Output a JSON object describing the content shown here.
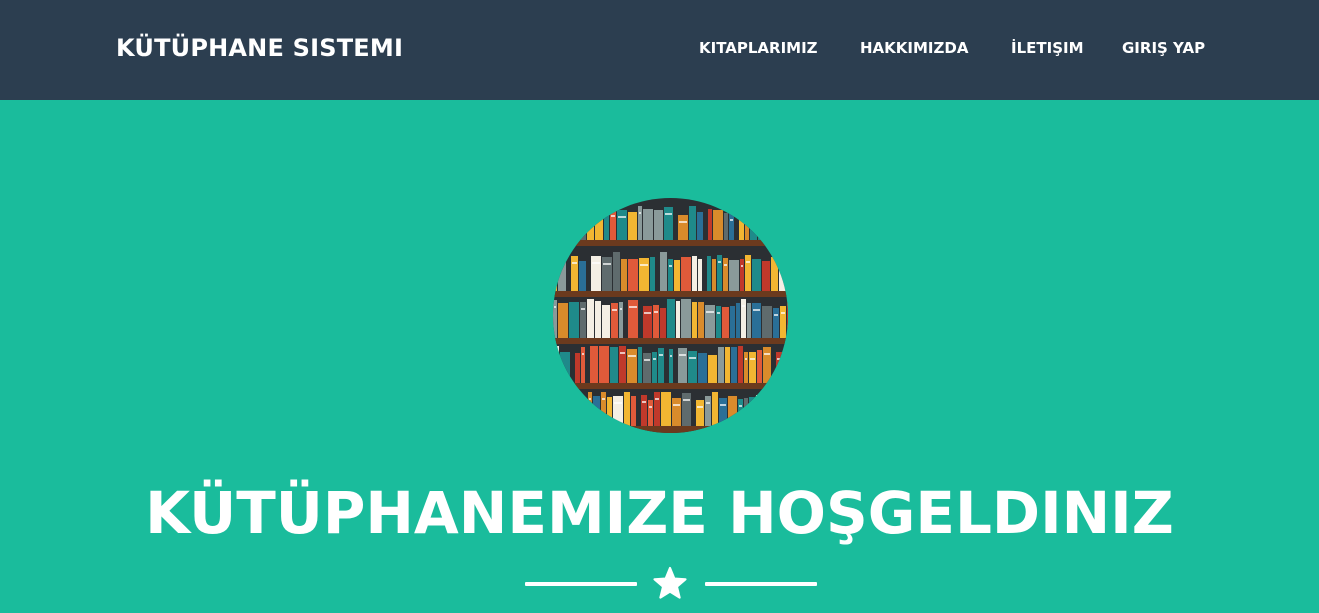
{
  "navbar": {
    "brand": "KÜTÜPHANE SISTEMI",
    "links": [
      {
        "label": "KITAPLARIMIZ"
      },
      {
        "label": "HAKKIMIZDA"
      },
      {
        "label": "İLETIŞIM"
      },
      {
        "label": "GIRIŞ YAP"
      }
    ]
  },
  "hero": {
    "title": "KÜTÜPHANEMIZE HOŞGELDINIZ",
    "image_icon": "bookshelf-icon",
    "divider_icon": "star-icon"
  },
  "colors": {
    "navbar_bg": "#2c3e50",
    "hero_bg": "#1abc9c",
    "text": "#ffffff"
  }
}
